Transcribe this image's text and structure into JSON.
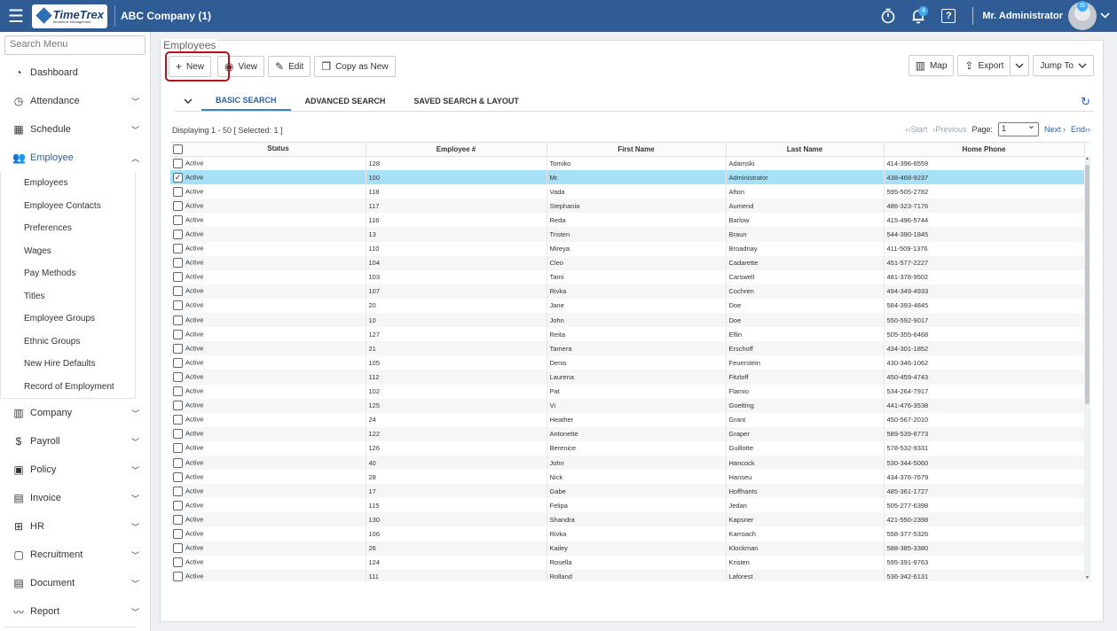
{
  "header": {
    "logo_name": "TimeTrex",
    "logo_sub": "Workforce Management",
    "company": "ABC Company (1)",
    "notification_count": "4",
    "user": "Mr. Administrator",
    "avatar_badge": "35"
  },
  "sidebar": {
    "search_placeholder": "Search Menu",
    "items": [
      {
        "label": "Dashboard"
      },
      {
        "label": "Attendance"
      },
      {
        "label": "Schedule"
      },
      {
        "label": "Employee"
      },
      {
        "label": "Company"
      },
      {
        "label": "Payroll"
      },
      {
        "label": "Policy"
      },
      {
        "label": "Invoice"
      },
      {
        "label": "HR"
      },
      {
        "label": "Recruitment"
      },
      {
        "label": "Document"
      },
      {
        "label": "Report"
      }
    ],
    "employee_sub": [
      "Employees",
      "Employee Contacts",
      "Preferences",
      "Wages",
      "Pay Methods",
      "Titles",
      "Employee Groups",
      "Ethnic Groups",
      "New Hire Defaults",
      "Record of Employment"
    ]
  },
  "main": {
    "title": "Employees",
    "toolbar": {
      "new": "New",
      "view": "View",
      "edit": "Edit",
      "copy": "Copy as New",
      "map": "Map",
      "export": "Export",
      "jump": "Jump To"
    },
    "tabs": {
      "basic": "BASIC SEARCH",
      "advanced": "ADVANCED SEARCH",
      "saved": "SAVED SEARCH & LAYOUT"
    },
    "displaying": "Displaying 1 - 50 [ Selected: 1 ]",
    "pager": {
      "start": "Start",
      "previous": "Previous",
      "page_label": "Page:",
      "page_value": "1",
      "next": "Next",
      "end": "End"
    },
    "columns": [
      "Status",
      "Employee #",
      "First Name",
      "Last Name",
      "Home Phone"
    ],
    "rows": [
      [
        "Active",
        "128",
        "Tomiko",
        "Adamski",
        "414-396-6559"
      ],
      [
        "Active",
        "100",
        "Mr.",
        "Administrator",
        "438-468-9237"
      ],
      [
        "Active",
        "118",
        "Vada",
        "Afton",
        "595-505-2782"
      ],
      [
        "Active",
        "117",
        "Stephania",
        "Aumend",
        "486-323-7176"
      ],
      [
        "Active",
        "116",
        "Reda",
        "Barlow",
        "415-496-5744"
      ],
      [
        "Active",
        "13",
        "Tristen",
        "Braun",
        "544-390-1845"
      ],
      [
        "Active",
        "110",
        "Mireya",
        "Broadnay",
        "411-509-1376"
      ],
      [
        "Active",
        "104",
        "Cleo",
        "Cadarette",
        "451-577-2227"
      ],
      [
        "Active",
        "103",
        "Tami",
        "Carswell",
        "481-378-9502"
      ],
      [
        "Active",
        "107",
        "Rivka",
        "Cochren",
        "494-349-4933"
      ],
      [
        "Active",
        "20",
        "Jane",
        "Doe",
        "584-393-4845"
      ],
      [
        "Active",
        "10",
        "John",
        "Doe",
        "550-592-9017"
      ],
      [
        "Active",
        "127",
        "Reita",
        "Eflin",
        "505-355-6468"
      ],
      [
        "Active",
        "21",
        "Tamera",
        "Erschoff",
        "434-301-1852"
      ],
      [
        "Active",
        "105",
        "Denis",
        "Feuerstein",
        "430-346-1062"
      ],
      [
        "Active",
        "112",
        "Laurena",
        "Fitzloff",
        "450-459-4743"
      ],
      [
        "Active",
        "102",
        "Pat",
        "Flamio",
        "534-264-7917"
      ],
      [
        "Active",
        "125",
        "Vi",
        "Goetting",
        "441-476-3538"
      ],
      [
        "Active",
        "24",
        "Heather",
        "Grant",
        "450-567-2010"
      ],
      [
        "Active",
        "122",
        "Antonette",
        "Graper",
        "589-539-8773"
      ],
      [
        "Active",
        "126",
        "Berenice",
        "Guillotte",
        "578-532-9331"
      ],
      [
        "Active",
        "40",
        "John",
        "Hancock",
        "530-344-5060"
      ],
      [
        "Active",
        "28",
        "Nick",
        "Hanseu",
        "434-376-7679"
      ],
      [
        "Active",
        "17",
        "Gabe",
        "Hoffhants",
        "485-361-1727"
      ],
      [
        "Active",
        "115",
        "Felipa",
        "Jedan",
        "505-277-6398"
      ],
      [
        "Active",
        "130",
        "Shandra",
        "Kapsner",
        "421-550-2398"
      ],
      [
        "Active",
        "106",
        "Rivka",
        "Karroach",
        "558-377-5326"
      ],
      [
        "Active",
        "26",
        "Kailey",
        "Klockman",
        "588-385-3380"
      ],
      [
        "Active",
        "124",
        "Rosella",
        "Kristen",
        "595-391-9763"
      ],
      [
        "Active",
        "111",
        "Rolland",
        "Laforest",
        "536-342-6131"
      ]
    ],
    "selected_row": 1
  }
}
